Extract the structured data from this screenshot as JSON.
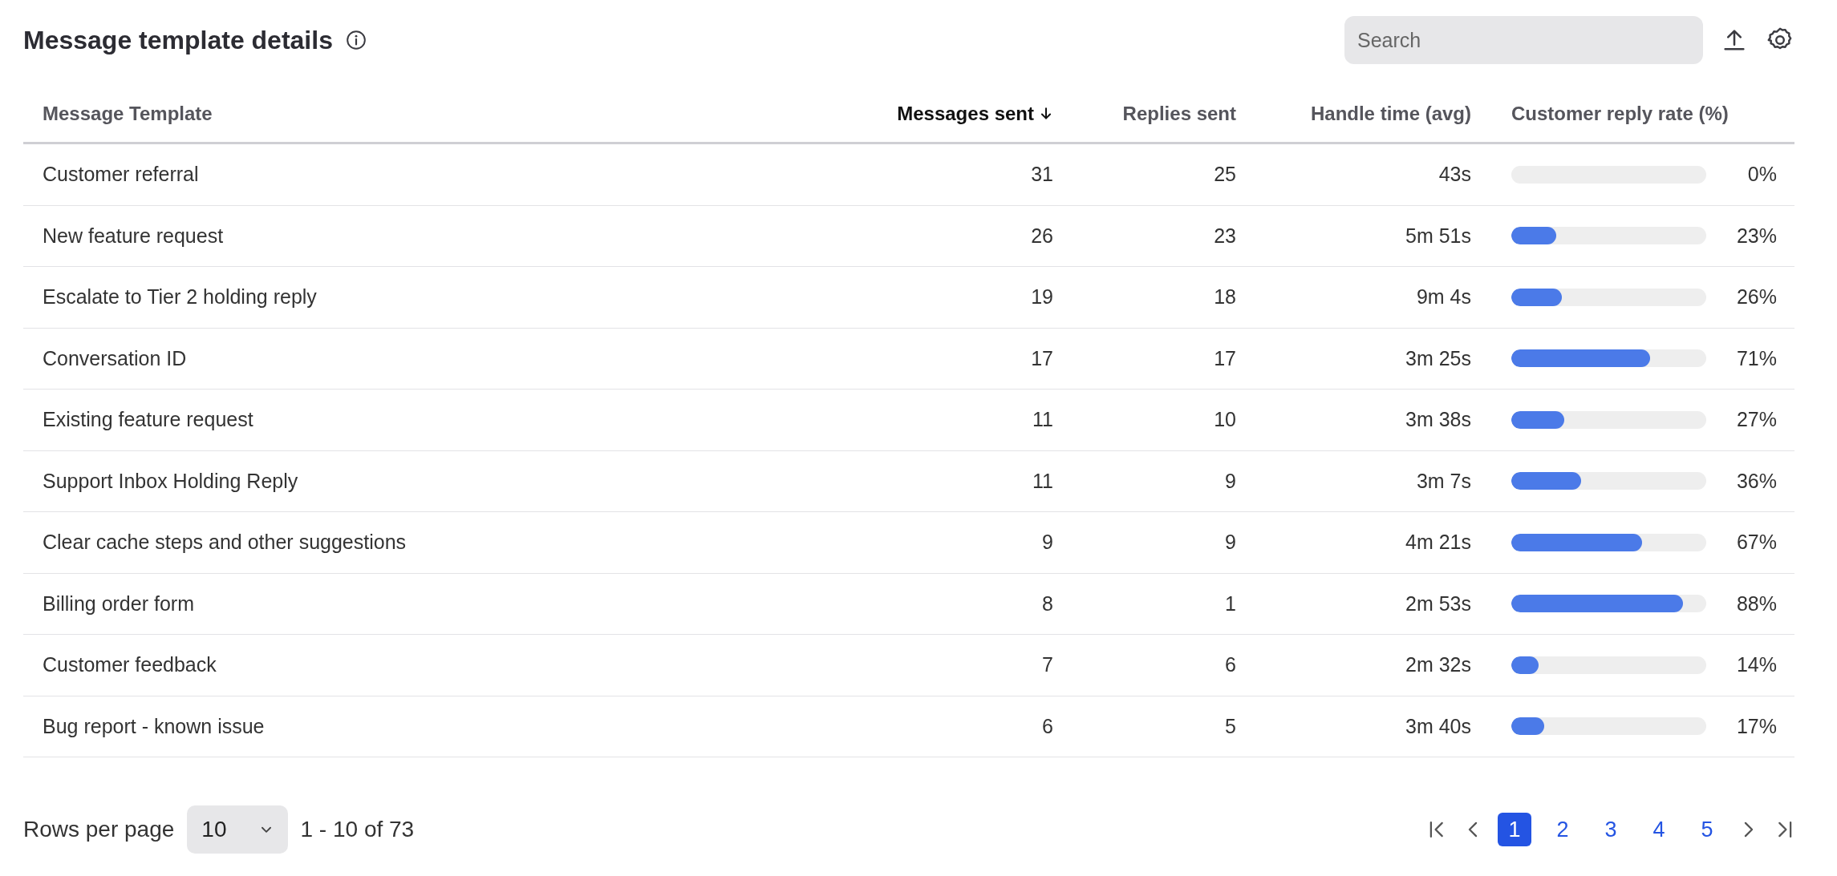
{
  "title": "Message template details",
  "search": {
    "placeholder": "Search"
  },
  "table": {
    "columns": [
      {
        "label": "Message Template",
        "sorted": false
      },
      {
        "label": "Messages sent",
        "sorted": true
      },
      {
        "label": "Replies sent",
        "sorted": false
      },
      {
        "label": "Handle time (avg)",
        "sorted": false
      },
      {
        "label": "Customer reply rate (%)",
        "sorted": false
      }
    ],
    "rows": [
      {
        "template": "Customer referral",
        "messages_sent": "31",
        "replies_sent": "25",
        "handle_time": "43s",
        "level": 0,
        "reply_rate": "0%"
      },
      {
        "template": "New feature request",
        "messages_sent": "26",
        "replies_sent": "23",
        "handle_time": "5m 51s",
        "level": 0.23,
        "reply_rate": "23%"
      },
      {
        "template": "Escalate to Tier 2 holding reply",
        "messages_sent": "19",
        "replies_sent": "18",
        "handle_time": "9m 4s",
        "level": 0.26,
        "reply_rate": "26%"
      },
      {
        "template": "Conversation ID",
        "messages_sent": "17",
        "replies_sent": "17",
        "handle_time": "3m 25s",
        "level": 0.71,
        "reply_rate": "71%"
      },
      {
        "template": "Existing feature request",
        "messages_sent": "11",
        "replies_sent": "10",
        "handle_time": "3m 38s",
        "level": 0.27,
        "reply_rate": "27%"
      },
      {
        "template": "Support Inbox Holding Reply",
        "messages_sent": "11",
        "replies_sent": "9",
        "handle_time": "3m 7s",
        "level": 0.36,
        "reply_rate": "36%"
      },
      {
        "template": "Clear cache steps and other suggestions",
        "messages_sent": "9",
        "replies_sent": "9",
        "handle_time": "4m 21s",
        "level": 0.67,
        "reply_rate": "67%"
      },
      {
        "template": "Billing order form",
        "messages_sent": "8",
        "replies_sent": "1",
        "handle_time": "2m 53s",
        "level": 0.88,
        "reply_rate": "88%"
      },
      {
        "template": "Customer feedback",
        "messages_sent": "7",
        "replies_sent": "6",
        "handle_time": "2m 32s",
        "level": 0.14,
        "reply_rate": "14%"
      },
      {
        "template": "Bug report - known issue",
        "messages_sent": "6",
        "replies_sent": "5",
        "handle_time": "3m 40s",
        "level": 0.17,
        "reply_rate": "17%"
      }
    ]
  },
  "pagination": {
    "rows_per_page_label": "Rows per page",
    "rows_per_page": "10",
    "range": "1 - 10 of 73",
    "pages": [
      {
        "label": "1",
        "selected": true
      },
      {
        "label": "2",
        "selected": false
      },
      {
        "label": "3",
        "selected": false
      },
      {
        "label": "4",
        "selected": false
      },
      {
        "label": "5",
        "selected": false
      }
    ]
  }
}
